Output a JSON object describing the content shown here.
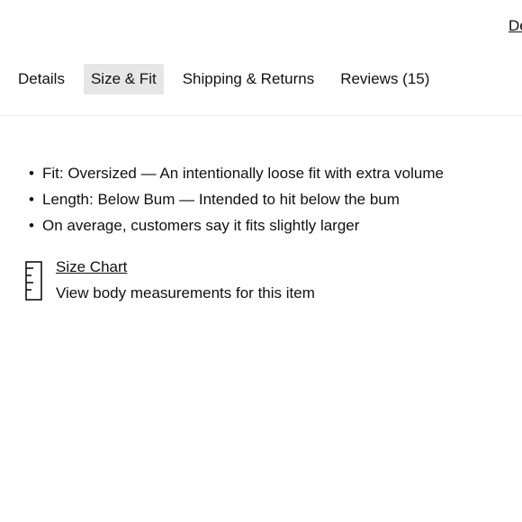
{
  "header": {
    "top_link": "De"
  },
  "tabs": [
    {
      "label": "Details",
      "active": false
    },
    {
      "label": "Size & Fit",
      "active": true
    },
    {
      "label": "Shipping & Returns",
      "active": false
    },
    {
      "label": "Reviews (15)",
      "active": false
    }
  ],
  "fit": {
    "items": [
      "Fit: Oversized — An intentionally loose fit with extra volume",
      "Length: Below Bum — Intended to hit below the bum",
      "On average, customers say it fits slightly larger"
    ]
  },
  "size_chart": {
    "icon": "ruler-icon",
    "link_label": "Size Chart",
    "description": "View body measurements for this item"
  }
}
